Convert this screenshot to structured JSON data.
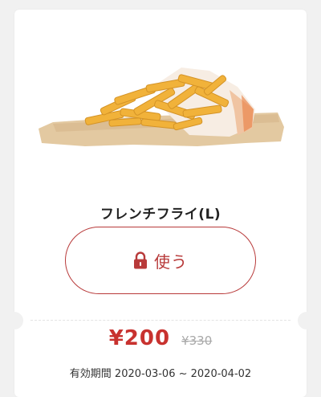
{
  "coupon": {
    "product_name": "フレンチフライ(L)",
    "use_button_label": "使う",
    "price": "¥200",
    "original_price": "¥330",
    "validity": "有効期間 2020-03-06 ~ 2020-04-02"
  },
  "colors": {
    "accent": "#c8322f",
    "background": "#f1f1f1",
    "card": "#ffffff"
  },
  "icons": {
    "lock": "lock-icon"
  }
}
